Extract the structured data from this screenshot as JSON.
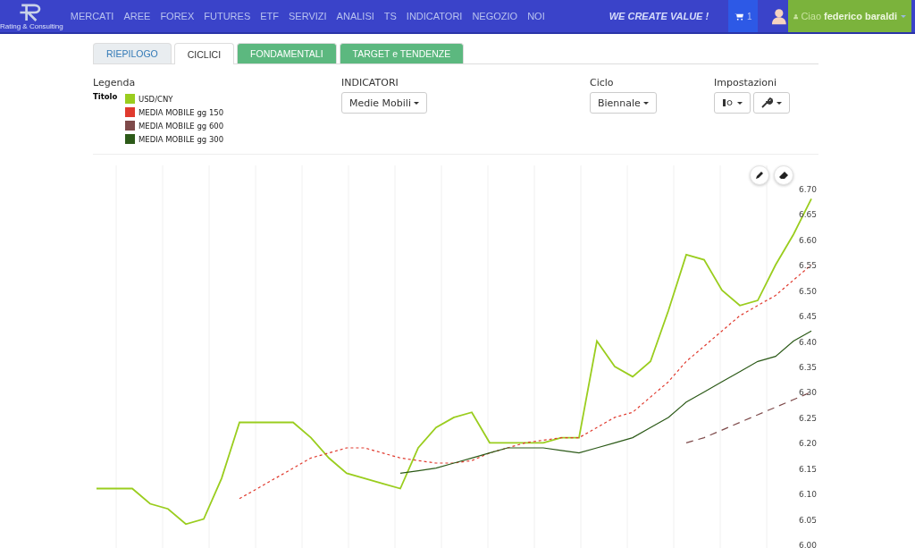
{
  "navbar": {
    "logo_caption": "Rating & Consulting",
    "menu": [
      "MERCATI",
      "AREE",
      "FOREX",
      "FUTURES",
      "ETF",
      "SERVIZI",
      "ANALISI",
      "TS",
      "INDICATORI",
      "NEGOZIO",
      "NOI"
    ],
    "slogan": "WE CREATE VALUE !",
    "cart_count": "1",
    "greeting": "Ciao",
    "user_name": "federico baraldi"
  },
  "tabs": [
    {
      "label": "RIEPILOGO",
      "selected": false,
      "color": "#e9edf0"
    },
    {
      "label": "CICLICI",
      "selected": true,
      "color": "#ffffff"
    },
    {
      "label": "FONDAMENTALI",
      "selected": false,
      "color": "#5cb87f"
    },
    {
      "label": "TARGET e TENDENZE",
      "selected": false,
      "color": "#5cb87f"
    }
  ],
  "legend": {
    "title": "Legenda",
    "row_label": "Titolo"
  },
  "indicators": {
    "label": "INDICATORI",
    "value": "Medie Mobili"
  },
  "cycle": {
    "label": "Ciclo",
    "value": "Biennale"
  },
  "settings": {
    "label": "Impostazioni"
  },
  "chart": {
    "chart_data": {
      "type": "line",
      "grid": true,
      "ylim": [
        6.0,
        6.7
      ],
      "yticks": [
        {
          "value": 6.0,
          "label": "6.00"
        },
        6.05,
        {
          "value": 6.1,
          "label": "6.10"
        },
        6.15,
        {
          "value": 6.2,
          "label": "6.20"
        },
        6.25,
        {
          "value": 6.3,
          "label": "6.30"
        },
        6.35,
        {
          "value": 6.4,
          "label": "6.40"
        },
        6.45,
        {
          "value": 6.5,
          "label": "6.50"
        },
        6.55,
        {
          "value": 6.6,
          "label": "6.60"
        },
        6.65,
        {
          "value": 6.7,
          "label": "6.70"
        }
      ],
      "series": [
        {
          "name": "USD/CNY",
          "color": "#9acd1e",
          "line_style": "solid",
          "values": [
            6.11,
            6.11,
            6.11,
            6.08,
            6.07,
            6.04,
            6.05,
            6.13,
            6.24,
            6.24,
            6.24,
            6.24,
            6.21,
            6.17,
            6.14,
            6.13,
            6.12,
            6.11,
            6.19,
            6.23,
            6.25,
            6.26,
            6.2,
            6.2,
            6.2,
            6.2,
            6.21,
            6.21,
            6.4,
            6.35,
            6.33,
            6.36,
            6.46,
            6.57,
            6.56,
            6.5,
            6.47,
            6.48,
            6.55,
            6.61,
            6.68
          ]
        },
        {
          "name": "MEDIA MOBILE gg 150",
          "color": "#e03a2e",
          "line_style": "dotted",
          "values": [
            null,
            null,
            null,
            null,
            null,
            null,
            null,
            null,
            6.09,
            6.11,
            6.13,
            6.15,
            6.17,
            6.18,
            6.19,
            6.19,
            6.18,
            6.17,
            6.165,
            6.16,
            6.16,
            6.165,
            6.18,
            6.19,
            6.2,
            6.205,
            6.21,
            6.21,
            6.23,
            6.25,
            6.26,
            6.29,
            6.32,
            6.36,
            6.39,
            6.42,
            6.45,
            6.47,
            6.49,
            6.52,
            6.55
          ]
        },
        {
          "name": "MEDIA MOBILE gg 600",
          "color": "#7e4a4a",
          "line_style": "dashed",
          "values": [
            null,
            null,
            null,
            null,
            null,
            null,
            null,
            null,
            null,
            null,
            null,
            null,
            null,
            null,
            null,
            null,
            null,
            null,
            null,
            null,
            null,
            null,
            null,
            null,
            null,
            null,
            null,
            null,
            null,
            null,
            null,
            null,
            null,
            6.2,
            6.21,
            6.225,
            6.24,
            6.255,
            6.27,
            6.285,
            6.3
          ]
        },
        {
          "name": "MEDIA MOBILE gg 300",
          "color": "#2c5a18",
          "line_style": "solid",
          "values": [
            null,
            null,
            null,
            null,
            null,
            null,
            null,
            null,
            null,
            null,
            null,
            null,
            null,
            null,
            null,
            null,
            null,
            6.14,
            6.145,
            6.15,
            6.16,
            6.17,
            6.18,
            6.19,
            6.19,
            6.19,
            6.185,
            6.18,
            6.19,
            6.2,
            6.21,
            6.23,
            6.25,
            6.28,
            6.3,
            6.32,
            6.34,
            6.36,
            6.37,
            6.4,
            6.42
          ]
        }
      ]
    }
  }
}
